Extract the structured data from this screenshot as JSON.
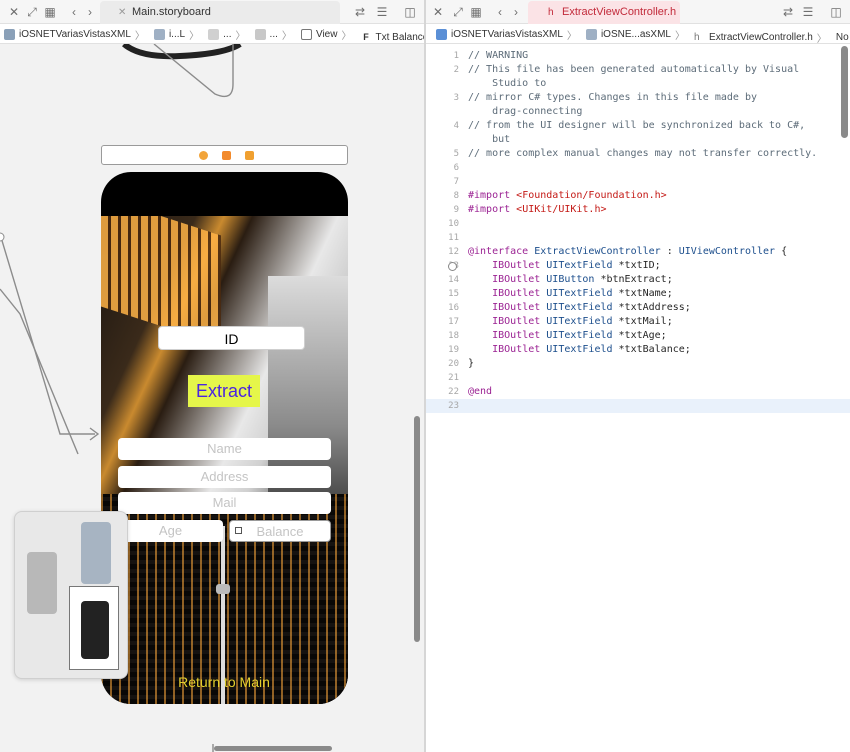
{
  "left": {
    "tab_title": "Main.storyboard",
    "breadcrumbs": [
      "iOSNETVariasVistasXML",
      "i...L",
      "...",
      "...",
      "View",
      "Txt Balance"
    ],
    "scene": {
      "id_field": "ID",
      "extract_button": "Extract",
      "name_placeholder": "Name",
      "address_placeholder": "Address",
      "mail_placeholder": "Mail",
      "age_placeholder": "Age",
      "balance_placeholder": "Balance",
      "return_button": "Return to Main"
    }
  },
  "right": {
    "tab_title": "ExtractViewController.h",
    "breadcrumbs": [
      "iOSNETVariasVistasXML",
      "iOSNE...asXML",
      "ExtractViewController.h",
      "No Selection"
    ],
    "current_line": 23,
    "lines": [
      {
        "n": "1",
        "parts": [
          {
            "c": "com",
            "t": "// WARNING"
          }
        ]
      },
      {
        "n": "2",
        "parts": [
          {
            "c": "com",
            "t": "// This file has been generated automatically by Visual"
          }
        ]
      },
      {
        "n": "",
        "parts": [
          {
            "c": "com",
            "t": "    Studio to"
          }
        ]
      },
      {
        "n": "3",
        "parts": [
          {
            "c": "com",
            "t": "// mirror C# types. Changes in this file made by"
          }
        ]
      },
      {
        "n": "",
        "parts": [
          {
            "c": "com",
            "t": "    drag-connecting"
          }
        ]
      },
      {
        "n": "4",
        "parts": [
          {
            "c": "com",
            "t": "// from the UI designer will be synchronized back to C#,"
          }
        ]
      },
      {
        "n": "",
        "parts": [
          {
            "c": "com",
            "t": "    but"
          }
        ]
      },
      {
        "n": "5",
        "parts": [
          {
            "c": "com",
            "t": "// more complex manual changes may not transfer correctly."
          }
        ]
      },
      {
        "n": "6",
        "parts": []
      },
      {
        "n": "7",
        "parts": []
      },
      {
        "n": "8",
        "parts": [
          {
            "c": "kw",
            "t": "#import "
          },
          {
            "c": "str",
            "t": "<Foundation/Foundation.h>"
          }
        ]
      },
      {
        "n": "9",
        "parts": [
          {
            "c": "kw",
            "t": "#import "
          },
          {
            "c": "str",
            "t": "<UIKit/UIKit.h>"
          }
        ]
      },
      {
        "n": "10",
        "parts": []
      },
      {
        "n": "11",
        "parts": []
      },
      {
        "n": "12",
        "parts": [
          {
            "c": "kw",
            "t": "@interface "
          },
          {
            "c": "type",
            "t": "ExtractViewController"
          },
          {
            "c": "plain",
            "t": " : "
          },
          {
            "c": "type",
            "t": "UIViewController"
          },
          {
            "c": "plain",
            "t": " {"
          }
        ]
      },
      {
        "n": "13",
        "parts": [
          {
            "c": "plain",
            "t": "    "
          },
          {
            "c": "kw",
            "t": "IBOutlet "
          },
          {
            "c": "type",
            "t": "UITextField"
          },
          {
            "c": "plain",
            "t": " *txtID;"
          }
        ]
      },
      {
        "n": "14",
        "parts": [
          {
            "c": "plain",
            "t": "    "
          },
          {
            "c": "kw",
            "t": "IBOutlet "
          },
          {
            "c": "type",
            "t": "UIButton"
          },
          {
            "c": "plain",
            "t": " *btnExtract;"
          }
        ]
      },
      {
        "n": "15",
        "parts": [
          {
            "c": "plain",
            "t": "    "
          },
          {
            "c": "kw",
            "t": "IBOutlet "
          },
          {
            "c": "type",
            "t": "UITextField"
          },
          {
            "c": "plain",
            "t": " *txtName;"
          }
        ]
      },
      {
        "n": "16",
        "parts": [
          {
            "c": "plain",
            "t": "    "
          },
          {
            "c": "kw",
            "t": "IBOutlet "
          },
          {
            "c": "type",
            "t": "UITextField"
          },
          {
            "c": "plain",
            "t": " *txtAddress;"
          }
        ]
      },
      {
        "n": "17",
        "parts": [
          {
            "c": "plain",
            "t": "    "
          },
          {
            "c": "kw",
            "t": "IBOutlet "
          },
          {
            "c": "type",
            "t": "UITextField"
          },
          {
            "c": "plain",
            "t": " *txtMail;"
          }
        ]
      },
      {
        "n": "18",
        "parts": [
          {
            "c": "plain",
            "t": "    "
          },
          {
            "c": "kw",
            "t": "IBOutlet "
          },
          {
            "c": "type",
            "t": "UITextField"
          },
          {
            "c": "plain",
            "t": " *txtAge;"
          }
        ]
      },
      {
        "n": "19",
        "parts": [
          {
            "c": "plain",
            "t": "    "
          },
          {
            "c": "kw",
            "t": "IBOutlet "
          },
          {
            "c": "type",
            "t": "UITextField"
          },
          {
            "c": "plain",
            "t": " *txtBalance;"
          }
        ]
      },
      {
        "n": "20",
        "parts": [
          {
            "c": "plain",
            "t": "}"
          }
        ]
      },
      {
        "n": "21",
        "parts": []
      },
      {
        "n": "22",
        "parts": [
          {
            "c": "kw",
            "t": "@end"
          }
        ]
      },
      {
        "n": "23",
        "parts": []
      }
    ]
  },
  "colors": {
    "comment": "#5d6c79",
    "keyword": "#9b2393",
    "string": "#c41a16",
    "type": "#1c4e8c",
    "extract_bg": "#e5f64a",
    "extract_text": "#4b24e0",
    "return_text": "#e3cf2e"
  }
}
